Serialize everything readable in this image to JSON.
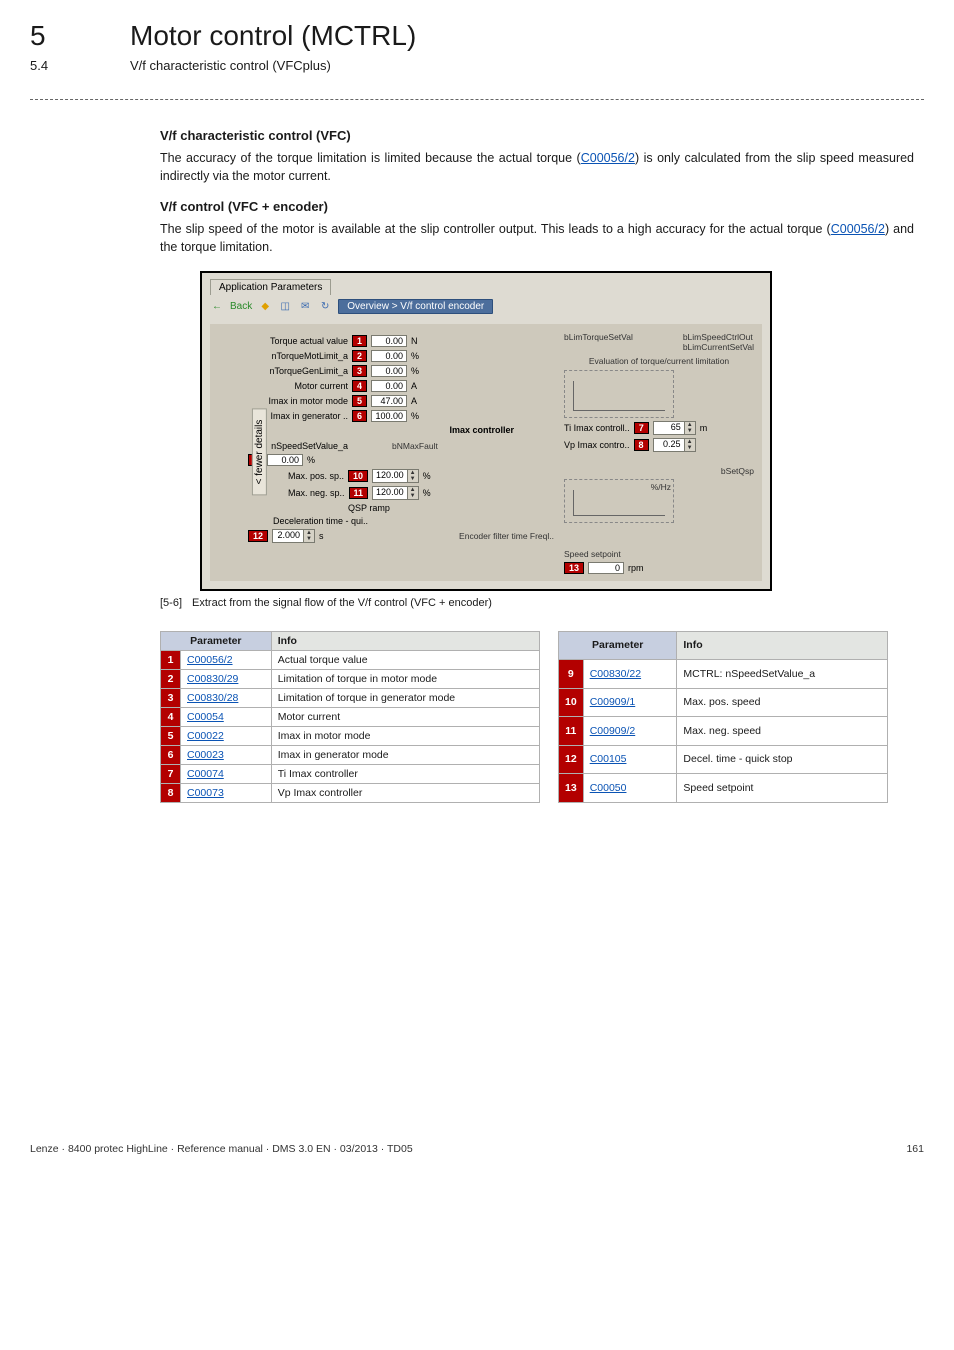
{
  "chapter": {
    "num": "5",
    "title": "Motor control (MCTRL)"
  },
  "section": {
    "num": "5.4",
    "title": "V/f characteristic control (VFCplus)"
  },
  "vfc": {
    "heading": "V/f characteristic control (VFC)",
    "text_a": "The accuracy of the torque limitation is limited because the actual torque (",
    "link": "C00056/2",
    "text_b": ") is only calculated from the slip speed measured indirectly via the motor current."
  },
  "vfcenc": {
    "heading": "V/f control (VFC + encoder)",
    "text_a": "The slip speed of the motor is available at the slip controller output. This leads to a high accuracy for the actual torque (",
    "link": "C00056/2",
    "text_b": ") and the torque limitation."
  },
  "shot": {
    "tab": "Application Parameters",
    "back": "Back",
    "crumb": "Overview > V/f control encoder",
    "fewer": "< fewer details",
    "fields": {
      "torque_actual_label": "Torque actual value",
      "torque_actual_val": "0.00",
      "torque_actual_unit": "N",
      "ntorq_mot_label": "nTorqueMotLimit_a",
      "ntorq_mot_val": "0.00",
      "ntorq_mot_unit": "%",
      "ntorq_gen_label": "nTorqueGenLimit_a",
      "ntorq_gen_val": "0.00",
      "ntorq_gen_unit": "%",
      "motor_cur_label": "Motor current",
      "motor_cur_val": "0.00",
      "motor_cur_unit": "A",
      "imax_mot_label": "Imax in motor mode",
      "imax_mot_val": "47.00",
      "imax_mot_unit": "A",
      "imax_gen_label": "Imax in generator ..",
      "imax_gen_val": "100.00",
      "imax_gen_unit": "%",
      "eval_label": "Evaluation of torque/current limitation",
      "imax_ctrl": "Imax controller",
      "ti_label": "Ti Imax controll..",
      "ti_val": "65",
      "ti_unit": "m",
      "vp_label": "Vp Imax contro..",
      "vp_val": "0.25",
      "nspeed_label": "nSpeedSetValue_a",
      "nspeed_val": "0.00",
      "nspeed_unit": "%",
      "maxpos_label": "Max. pos. sp..",
      "maxpos_val": "120.00",
      "maxpos_unit": "%",
      "maxneg_label": "Max. neg. sp..",
      "maxneg_val": "120.00",
      "maxneg_unit": "%",
      "qsp": "QSP ramp",
      "decel_label": "Deceleration time - qui..",
      "decel_val": "2.000",
      "decel_unit": "s",
      "btorq": "bLimTorqueSetVal",
      "bspeed1": "bLimSpeedCtrlOut",
      "bspeed2": "bLimCurrentSetVal",
      "bnmax": "bNMaxFault",
      "bsetqsp": "bSetQsp",
      "hz": "%/Hz",
      "speed_sp": "Speed setpoint",
      "speed_sp_val": "0",
      "speed_sp_unit": "rpm",
      "enc_filt": "Encoder filter time Freql.."
    },
    "badges": {
      "b1": "1",
      "b2": "2",
      "b3": "3",
      "b4": "4",
      "b5": "5",
      "b6": "6",
      "b7": "7",
      "b8": "8",
      "b9": "9",
      "b10": "10",
      "b11": "11",
      "b12": "12",
      "b13": "13"
    }
  },
  "figcap": {
    "id": "[5-6]",
    "text": "Extract from the signal flow of the V/f control (VFC + encoder)"
  },
  "table1": {
    "h_param": "Parameter",
    "h_info": "Info",
    "rows": [
      {
        "n": "1",
        "p": "C00056/2",
        "i": "Actual torque value"
      },
      {
        "n": "2",
        "p": "C00830/29",
        "i": "Limitation of torque in motor mode"
      },
      {
        "n": "3",
        "p": "C00830/28",
        "i": "Limitation of torque in generator mode"
      },
      {
        "n": "4",
        "p": "C00054",
        "i": "Motor current"
      },
      {
        "n": "5",
        "p": "C00022",
        "i": "Imax in motor mode"
      },
      {
        "n": "6",
        "p": "C00023",
        "i": "Imax in generator mode"
      },
      {
        "n": "7",
        "p": "C00074",
        "i": "Ti Imax controller"
      },
      {
        "n": "8",
        "p": "C00073",
        "i": "Vp Imax controller"
      }
    ]
  },
  "table2": {
    "h_param": "Parameter",
    "h_info": "Info",
    "rows": [
      {
        "n": "9",
        "p": "C00830/22",
        "i": "MCTRL: nSpeedSetValue_a"
      },
      {
        "n": "10",
        "p": "C00909/1",
        "i": "Max. pos. speed"
      },
      {
        "n": "11",
        "p": "C00909/2",
        "i": "Max. neg. speed"
      },
      {
        "n": "12",
        "p": "C00105",
        "i": "Decel. time - quick stop"
      },
      {
        "n": "13",
        "p": "C00050",
        "i": "Speed setpoint"
      }
    ]
  },
  "footer": {
    "left": "Lenze · 8400 protec HighLine · Reference manual · DMS 3.0 EN · 03/2013 · TD05",
    "page": "161"
  }
}
